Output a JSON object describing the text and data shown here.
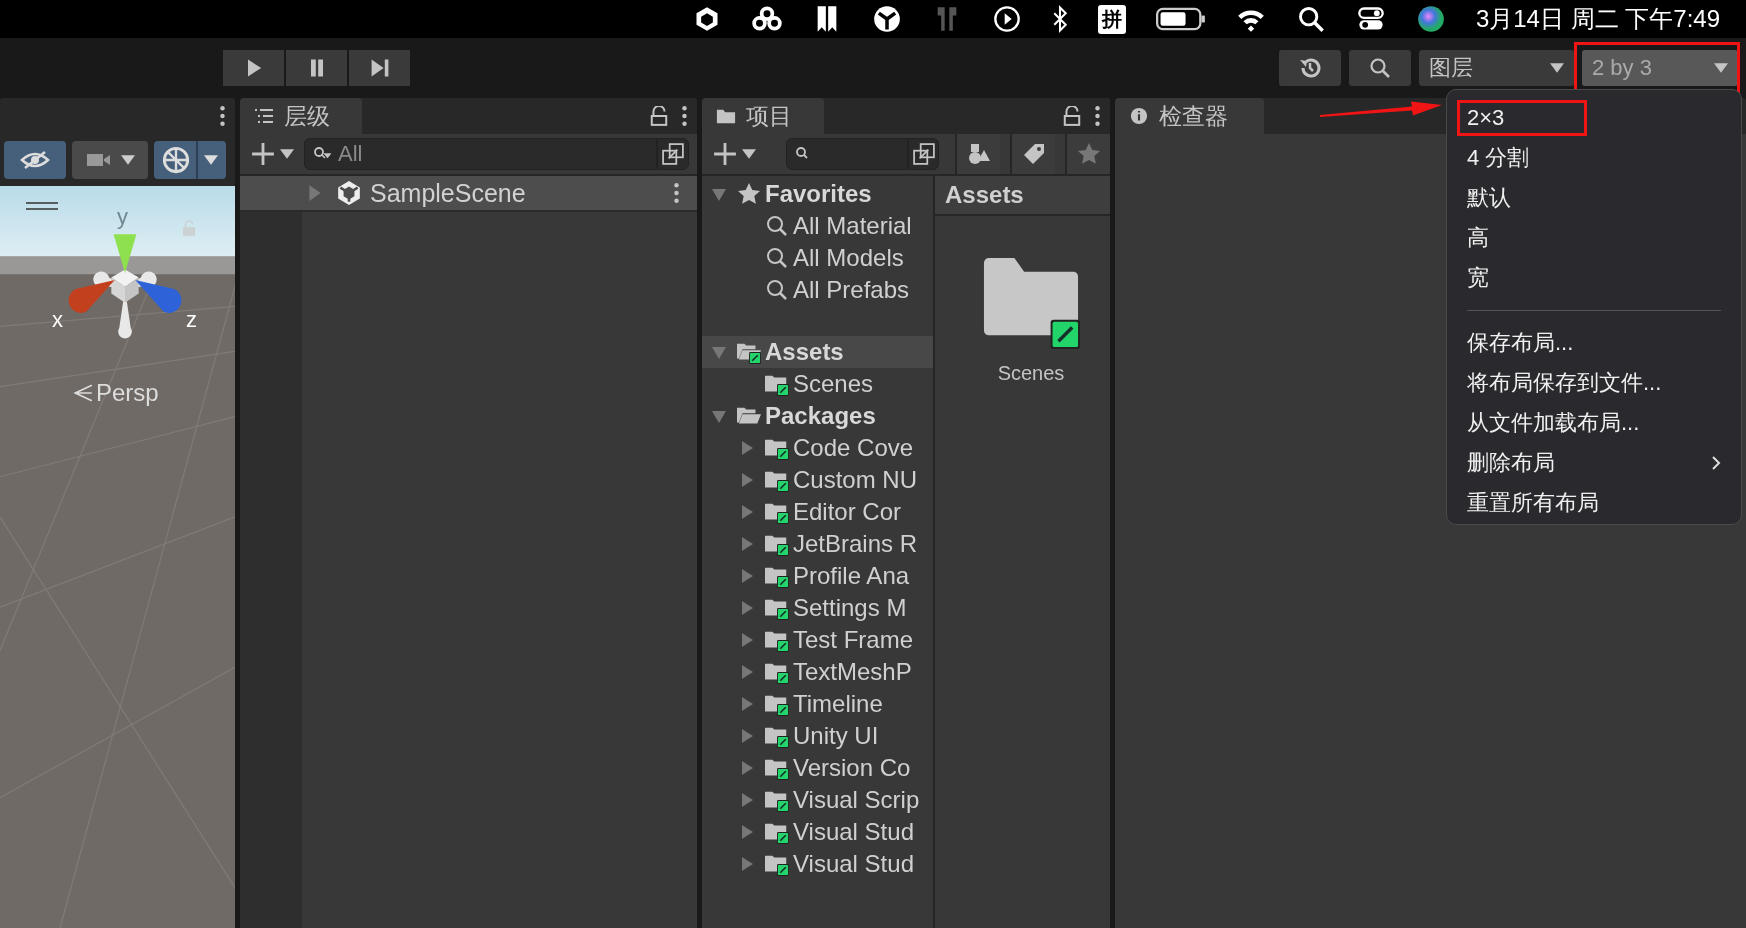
{
  "menu_bar": {
    "input_method": "拼",
    "datetime": "3月14日 周二 下午7:49"
  },
  "toolbar": {
    "layers_dropdown": "图层",
    "layout_dropdown": {
      "value": "2 by 3",
      "highlighted": true
    }
  },
  "layout_menu": {
    "sections": [
      [
        {
          "label": "2×3",
          "highlighted": true,
          "has_submenu": false
        },
        {
          "label": "4 分割",
          "highlighted": false,
          "has_submenu": false
        },
        {
          "label": "默认",
          "highlighted": false,
          "has_submenu": false
        },
        {
          "label": "高",
          "highlighted": false,
          "has_submenu": false
        },
        {
          "label": "宽",
          "highlighted": false,
          "has_submenu": false
        }
      ],
      [
        {
          "label": "保存布局...",
          "highlighted": false,
          "has_submenu": false
        },
        {
          "label": "将布局保存到文件...",
          "highlighted": false,
          "has_submenu": false
        },
        {
          "label": "从文件加载布局...",
          "highlighted": false,
          "has_submenu": false
        },
        {
          "label": "删除布局",
          "highlighted": false,
          "has_submenu": true
        },
        {
          "label": "重置所有布局",
          "highlighted": false,
          "has_submenu": false
        }
      ]
    ]
  },
  "scene": {
    "visibility_on": true,
    "camera_on": false,
    "gizmos_on": true,
    "axis_labels": {
      "y": "y",
      "x": "x",
      "z": "z"
    },
    "projection": "Persp"
  },
  "hierarchy": {
    "tab": "层级",
    "search": {
      "placeholder": "All"
    },
    "rows": [
      {
        "label": "SampleScene",
        "expanded": false
      }
    ]
  },
  "project": {
    "tab": "项目",
    "tree": [
      {
        "label": "Favorites",
        "kind": "favorites",
        "expanded": true,
        "selected": false,
        "children": [
          {
            "label": "All Material",
            "kind": "saved-search",
            "selected": false
          },
          {
            "label": "All Models",
            "kind": "saved-search",
            "selected": false
          },
          {
            "label": "All Prefabs",
            "kind": "saved-search",
            "selected": false
          }
        ]
      },
      {
        "label": "Assets",
        "kind": "folder",
        "expanded": true,
        "selected": true,
        "children": [
          {
            "label": "Scenes",
            "kind": "folder",
            "selected": false
          }
        ]
      },
      {
        "label": "Packages",
        "kind": "packages",
        "expanded": true,
        "selected": false,
        "children": [
          {
            "label": "Code Cove",
            "kind": "folder",
            "expanded": false,
            "selected": false
          },
          {
            "label": "Custom NU",
            "kind": "folder",
            "expanded": false,
            "selected": false
          },
          {
            "label": "Editor Cor",
            "kind": "folder",
            "expanded": false,
            "selected": false
          },
          {
            "label": "JetBrains R",
            "kind": "folder",
            "expanded": false,
            "selected": false
          },
          {
            "label": "Profile Ana",
            "kind": "folder",
            "expanded": false,
            "selected": false
          },
          {
            "label": "Settings M",
            "kind": "folder",
            "expanded": false,
            "selected": false
          },
          {
            "label": "Test Frame",
            "kind": "folder",
            "expanded": false,
            "selected": false
          },
          {
            "label": "TextMeshP",
            "kind": "folder",
            "expanded": false,
            "selected": false
          },
          {
            "label": "Timeline",
            "kind": "folder",
            "expanded": false,
            "selected": false
          },
          {
            "label": "Unity UI",
            "kind": "folder",
            "expanded": false,
            "selected": false
          },
          {
            "label": "Version Co",
            "kind": "folder",
            "expanded": false,
            "selected": false
          },
          {
            "label": "Visual Scrip",
            "kind": "folder",
            "expanded": false,
            "selected": false
          },
          {
            "label": "Visual Stud",
            "kind": "folder",
            "expanded": false,
            "selected": false
          },
          {
            "label": "Visual Stud",
            "kind": "folder",
            "expanded": false,
            "selected": false
          }
        ]
      }
    ],
    "breadcrumb": "Assets",
    "items": [
      {
        "label": "Scenes"
      }
    ]
  },
  "inspector": {
    "tab": "检查器"
  }
}
